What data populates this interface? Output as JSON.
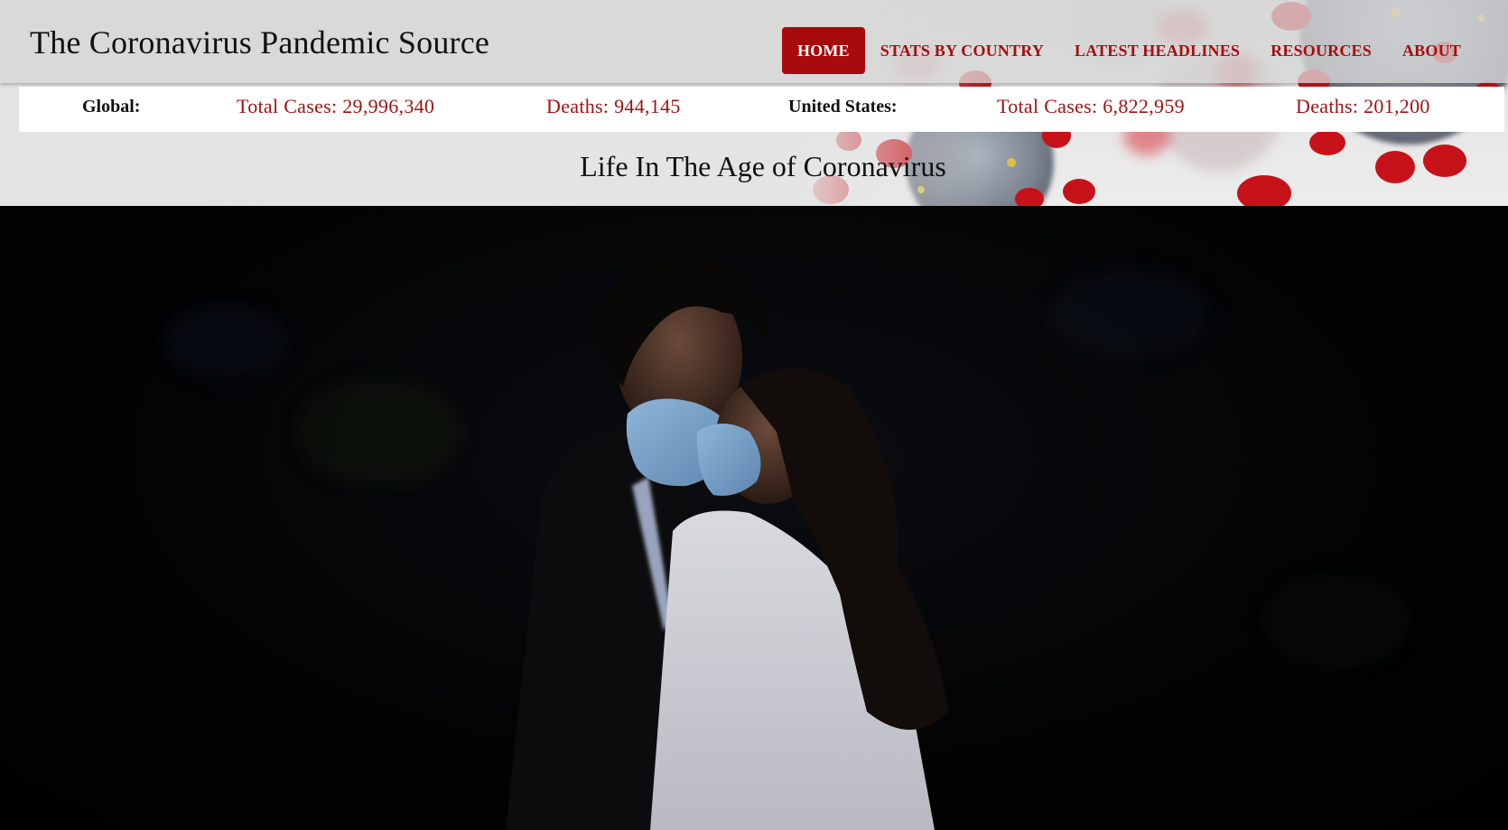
{
  "header": {
    "site_title": "The Coronavirus Pandemic Source",
    "nav": [
      {
        "label": "HOME",
        "active": true
      },
      {
        "label": "STATS BY COUNTRY",
        "active": false
      },
      {
        "label": "LATEST HEADLINES",
        "active": false
      },
      {
        "label": "RESOURCES",
        "active": false
      },
      {
        "label": "ABOUT",
        "active": false
      }
    ]
  },
  "stats": {
    "global": {
      "label": "Global:",
      "total_cases": "Total Cases: 29,996,340",
      "deaths": "Deaths: 944,145"
    },
    "united_states": {
      "label": "United States:",
      "total_cases": "Total Cases: 6,822,959",
      "deaths": "Deaths: 201,200"
    }
  },
  "hero": {
    "subtitle": "Life In The Age of Coronavirus",
    "image": "couple-wearing-face-masks-photo"
  },
  "colors": {
    "accent": "#a80b0b",
    "nav_text": "#a80d0d",
    "stat_text": "#a31212",
    "header_bg": "#dcdcdc",
    "hero_bg": "#020203"
  }
}
